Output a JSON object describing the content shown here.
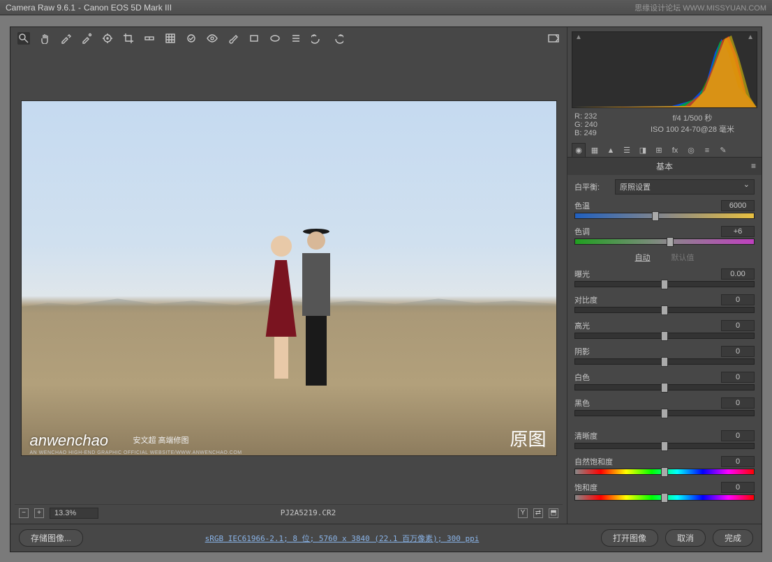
{
  "titlebar": {
    "app": "Camera Raw 9.6.1",
    "camera": "Canon EOS 5D Mark III"
  },
  "watermark": "思缘设计论坛  WWW.MISSYUAN.COM",
  "toolbar": {
    "tools": [
      {
        "name": "zoom-tool",
        "icon": "zoom"
      },
      {
        "name": "hand-tool",
        "icon": "hand"
      },
      {
        "name": "wb-eyedropper",
        "icon": "eyedrop"
      },
      {
        "name": "color-sampler",
        "icon": "eyedrop2"
      },
      {
        "name": "targeted-adjust",
        "icon": "target"
      },
      {
        "name": "crop-tool",
        "icon": "crop"
      },
      {
        "name": "straighten-tool",
        "icon": "level"
      },
      {
        "name": "transform-tool",
        "icon": "grid"
      },
      {
        "name": "spot-removal",
        "icon": "heal"
      },
      {
        "name": "redeye-tool",
        "icon": "eye"
      },
      {
        "name": "adjustment-brush",
        "icon": "brush"
      },
      {
        "name": "graduated-filter",
        "icon": "rect"
      },
      {
        "name": "radial-filter",
        "icon": "ellipse"
      },
      {
        "name": "preferences",
        "icon": "list"
      },
      {
        "name": "rotate-ccw",
        "icon": "ccw"
      },
      {
        "name": "rotate-cw",
        "icon": "cw"
      }
    ],
    "preview_toggle": "preview"
  },
  "preview": {
    "credit": "anwenchao",
    "credit_sub": "安文超 高端修图",
    "credit_sub2": "AN WENCHAO HIGH-END GRAPHIC OFFICIAL WEBSITE/WWW.ANWENCHAO.COM",
    "label": "原图"
  },
  "statusbar": {
    "zoom": "13.3%",
    "filename": "PJ2A5219.CR2"
  },
  "rgb": {
    "r": "R: 232",
    "g": "G: 240",
    "b": "B: 249"
  },
  "exif": {
    "line1": "f/4 1/500 秒",
    "line2": "ISO 100 24-70@28 毫米"
  },
  "tabs": [
    {
      "name": "basic",
      "active": true
    },
    {
      "name": "tone-curve"
    },
    {
      "name": "detail"
    },
    {
      "name": "hsl"
    },
    {
      "name": "split-toning"
    },
    {
      "name": "lens"
    },
    {
      "name": "effects"
    },
    {
      "name": "camera-calib"
    },
    {
      "name": "presets"
    },
    {
      "name": "snapshots"
    }
  ],
  "panel": {
    "title": "基本",
    "wb_label": "白平衡:",
    "wb_value": "原照设置",
    "auto_label": "自动",
    "default_label": "默认值",
    "sliders": [
      {
        "key": "temp",
        "label": "色温",
        "value": "6000",
        "pos": 45,
        "track": "temp"
      },
      {
        "key": "tint",
        "label": "色调",
        "value": "+6",
        "pos": 53,
        "track": "tint"
      },
      {
        "key": "exposure",
        "label": "曝光",
        "value": "0.00",
        "pos": 50
      },
      {
        "key": "contrast",
        "label": "对比度",
        "value": "0",
        "pos": 50
      },
      {
        "key": "highlights",
        "label": "高光",
        "value": "0",
        "pos": 50
      },
      {
        "key": "shadows",
        "label": "阴影",
        "value": "0",
        "pos": 50
      },
      {
        "key": "whites",
        "label": "白色",
        "value": "0",
        "pos": 50
      },
      {
        "key": "blacks",
        "label": "黑色",
        "value": "0",
        "pos": 50
      },
      {
        "key": "clarity",
        "label": "清晰度",
        "value": "0",
        "pos": 50
      },
      {
        "key": "vibrance",
        "label": "自然饱和度",
        "value": "0",
        "pos": 50,
        "track": "sat"
      },
      {
        "key": "saturation",
        "label": "饱和度",
        "value": "0",
        "pos": 50,
        "track": "sat"
      }
    ]
  },
  "footer": {
    "save": "存储图像...",
    "info": "sRGB IEC61966-2.1; 8 位; 5760 x 3840 (22.1 百万像素); 300 ppi",
    "open": "打开图像",
    "cancel": "取消",
    "done": "完成"
  }
}
